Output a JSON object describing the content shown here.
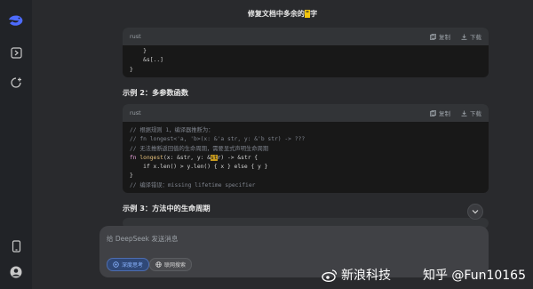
{
  "conversation": {
    "title_prefix": "修复文档中多余的",
    "title_highlight": "\"",
    "title_suffix": "字"
  },
  "sidebar": {
    "icons": [
      "deepseek-logo",
      "expand-sidebar",
      "new-chat",
      "mobile-app",
      "profile"
    ]
  },
  "code_block_1": {
    "language": "rust",
    "copy_label": "复制",
    "download_label": "下载",
    "lines": [
      "    }",
      "    &s[..]",
      "}"
    ]
  },
  "example2": {
    "heading": "示例 2：多参数函数",
    "language": "rust",
    "copy_label": "复制",
    "download_label": "下载",
    "comment1": "// 根据规则 1，编译器推断为：",
    "comment2": "// fn longest<'a, 'b>(x: &'a str, y: &'b str) -> ???",
    "comment3": "// 无法推断返回值的生命周期，需要显式声明生命周期",
    "fn_kw": "fn",
    "fn_name": "longest",
    "fn_params_pre": "(x: &str, y: &",
    "fn_params_sel": "st",
    "fn_params_post": "r) -> &str {",
    "line5": "    if x.len() > y.len() { x } else { y }",
    "line6": "}",
    "comment4": "// 编译错误：missing lifetime specifier"
  },
  "example3": {
    "heading": "示例 3：方法中的生命周期"
  },
  "composer": {
    "placeholder": "给 DeepSeek 发送消息",
    "deep_think_label": "深度思考",
    "web_search_label": "联网搜索"
  },
  "watermark": {
    "weibo": "新浪科技",
    "zhihu": "知乎 @Fun10165"
  },
  "colors": {
    "background": "#292a2d",
    "code_bg": "#181818",
    "accent": "#4d6bfe",
    "highlight": "#f1c40f"
  }
}
